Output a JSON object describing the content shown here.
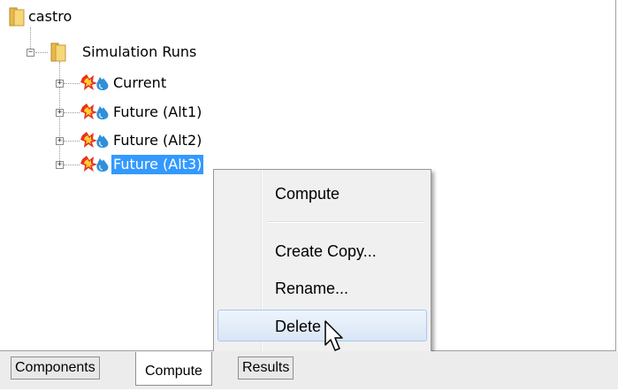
{
  "tree": {
    "root": {
      "label": "castro",
      "icon": "folder-icon"
    },
    "simulation_runs": {
      "label": "Simulation Runs",
      "icon": "folder-icon",
      "expanded": true
    },
    "runs": [
      {
        "label": "Current",
        "icon": "simulation-run-icon"
      },
      {
        "label": "Future (Alt1)",
        "icon": "simulation-run-icon"
      },
      {
        "label": "Future (Alt2)",
        "icon": "simulation-run-icon"
      },
      {
        "label": "Future (Alt3)",
        "icon": "simulation-run-icon",
        "selected": true
      }
    ]
  },
  "context_menu": {
    "items": [
      {
        "label": "Compute"
      },
      {
        "label": "Create Copy..."
      },
      {
        "label": "Rename..."
      },
      {
        "label": "Delete",
        "hover": true
      }
    ]
  },
  "tabs": [
    {
      "label": "Components"
    },
    {
      "label": "Compute",
      "active": true
    },
    {
      "label": "Results"
    }
  ],
  "colors": {
    "selection": "#3399ff",
    "menu_background": "#f0f0f0",
    "hover_border": "#a8c8ec"
  }
}
